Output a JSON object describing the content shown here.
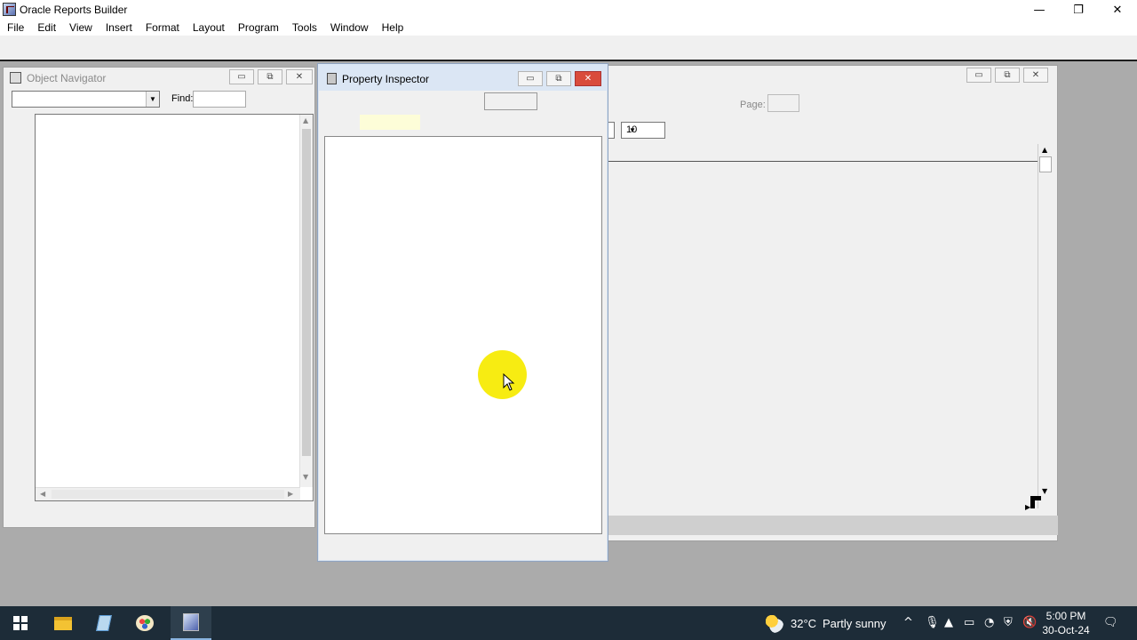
{
  "app": {
    "title": "Oracle Reports Builder"
  },
  "window_controls": {
    "minimize": "—",
    "maximize": "❐",
    "close": "✕"
  },
  "menu": [
    "File",
    "Edit",
    "View",
    "Insert",
    "Format",
    "Layout",
    "Program",
    "Tools",
    "Window",
    "Help"
  ],
  "object_navigator": {
    "title": "Object Navigator",
    "find_label": "Find:",
    "find_value": "",
    "combo_value": ""
  },
  "property_inspector": {
    "title": "Property Inspector",
    "input_value": ""
  },
  "report_editor": {
    "page_label": "Page:",
    "page_value": "",
    "zoom_value": "10"
  },
  "mdi_buttons": {
    "minimize": "▭",
    "restore": "⧉",
    "close": "✕"
  },
  "taskbar": {
    "weather_temp": "32°C",
    "weather_desc": "Partly sunny",
    "time": "5:00 PM",
    "date": "30-Oct-24",
    "tray_icons": [
      "chevron-up-icon",
      "microphone-icon",
      "google-drive-icon",
      "battery-icon",
      "wifi-icon",
      "security-icon",
      "speaker-muted-icon",
      "notification-icon"
    ]
  },
  "colors": {
    "desktop": "#ababab",
    "taskbar": "#1d2c38",
    "cursor_highlight": "#f7ec12",
    "close_button": "#d94b3c"
  }
}
